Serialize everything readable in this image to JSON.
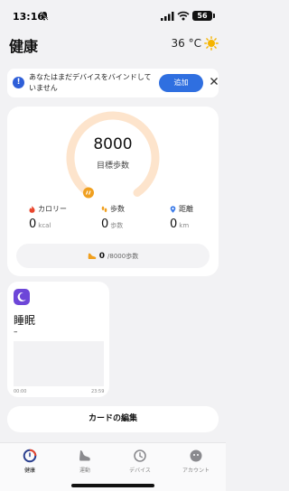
{
  "status_bar": {
    "time": "13:16",
    "battery": "56",
    "icons": [
      "bell-off-icon",
      "signal-icon",
      "wifi-icon",
      "battery-icon"
    ]
  },
  "header": {
    "title": "健康",
    "temperature": "36 °C",
    "weather_icon": "sun-icon"
  },
  "notice": {
    "text": "あなたはまだデバイスをバインドしていません",
    "add_label": "追加",
    "icon": "info-icon"
  },
  "steps_card": {
    "steps": "8000",
    "steps_label": "目標歩数",
    "progress_fraction": 0,
    "stats": [
      {
        "label": "カロリー",
        "value": "0",
        "unit": "kcal",
        "icon": "flame-icon",
        "color": "#e8452c"
      },
      {
        "label": "歩数",
        "value": "0",
        "unit": "歩数",
        "icon": "footprints-icon",
        "color": "#f0a020"
      },
      {
        "label": "距離",
        "value": "0",
        "unit": "km",
        "icon": "location-pin-icon",
        "color": "#3b7ae8"
      }
    ],
    "goal": {
      "current": "0",
      "target": "/8000歩数"
    }
  },
  "sleep_card": {
    "title": "睡眠",
    "value": "–",
    "time_start": "00:00",
    "time_end": "23:59"
  },
  "edit_cards_label": "カードの編集",
  "tabs": [
    {
      "label": "健康",
      "icon": "health-ring-icon",
      "active": true
    },
    {
      "label": "運動",
      "icon": "shoe-icon",
      "active": false
    },
    {
      "label": "デバイス",
      "icon": "watch-icon",
      "active": false
    },
    {
      "label": "アカウント",
      "icon": "face-icon",
      "active": false
    }
  ],
  "colors": {
    "accent": "#2f6fe0",
    "ring": "#fde4cc",
    "ring_knob": "#f0a020",
    "sleep": "#6d46d8",
    "background": "#f2f2f4"
  }
}
